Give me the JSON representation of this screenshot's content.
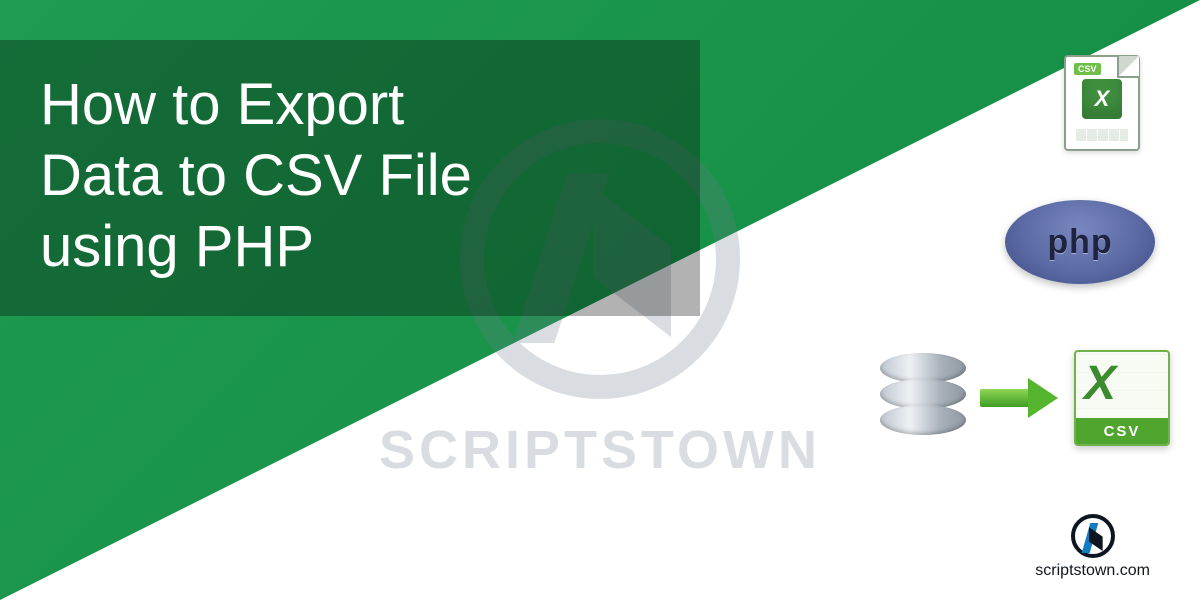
{
  "title": {
    "line1": "How to Export",
    "line2": "Data to CSV File",
    "line3": "using PHP"
  },
  "watermark": {
    "text": "SCRIPTSTOWN"
  },
  "icons": {
    "csv_tab": "CSV",
    "xl_mark": "X",
    "php_label": "php",
    "bigx": "X",
    "csv_band": "CSV"
  },
  "brand": {
    "url_text": "scriptstown.com"
  }
}
